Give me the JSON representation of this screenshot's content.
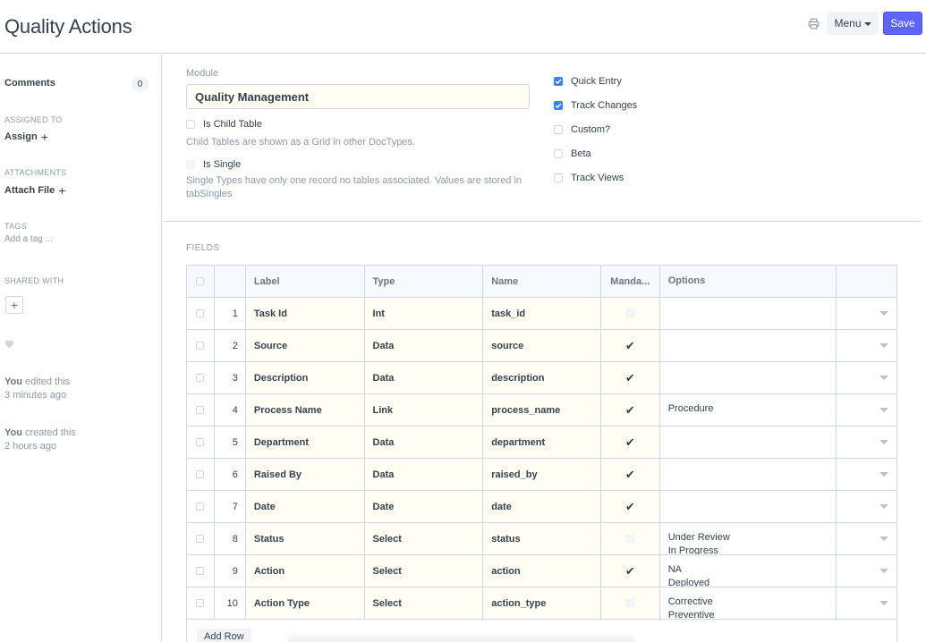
{
  "header": {
    "title": "Quality Actions",
    "menu_label": "Menu",
    "save_label": "Save",
    "print_icon": "printer-icon"
  },
  "sidebar": {
    "comments_label": "Comments",
    "comments_count": "0",
    "assigned_to_label": "Assigned To",
    "assign_label": "Assign",
    "attachments_label": "Attachments",
    "attach_label": "Attach File",
    "tags_label": "Tags",
    "add_tag_placeholder": "Add a tag ...",
    "shared_with_label": "Shared With",
    "activity": [
      {
        "who": "You",
        "what": " edited this",
        "when": "3 minutes ago"
      },
      {
        "who": "You",
        "what": " created this",
        "when": "2 hours ago"
      }
    ]
  },
  "form": {
    "module_label": "Module",
    "module_value": "Quality Management",
    "is_child_table_label": "Is Child Table",
    "is_child_table_help": "Child Tables are shown as a Grid in other DocTypes.",
    "is_single_label": "Is Single",
    "is_single_help": "Single Types have only one record no tables associated. Values are stored in tabSingles",
    "right_checks": [
      {
        "label": "Quick Entry",
        "checked": true
      },
      {
        "label": "Track Changes",
        "checked": true
      },
      {
        "label": "Custom?",
        "checked": false
      },
      {
        "label": "Beta",
        "checked": false
      },
      {
        "label": "Track Views",
        "checked": false
      }
    ]
  },
  "fields": {
    "section_label": "FIELDS",
    "columns": {
      "label": "Label",
      "type": "Type",
      "name": "Name",
      "mandatory": "Manda...",
      "options": "Options"
    },
    "rows": [
      {
        "idx": "1",
        "label": "Task Id",
        "type": "Int",
        "name": "task_id",
        "mandatory": false,
        "options": [
          "",
          ""
        ]
      },
      {
        "idx": "2",
        "label": "Source",
        "type": "Data",
        "name": "source",
        "mandatory": true,
        "options": [
          "",
          ""
        ]
      },
      {
        "idx": "3",
        "label": "Description",
        "type": "Data",
        "name": "description",
        "mandatory": true,
        "options": [
          "",
          ""
        ]
      },
      {
        "idx": "4",
        "label": "Process Name",
        "type": "Link",
        "name": "process_name",
        "mandatory": true,
        "options": [
          "Procedure",
          ""
        ]
      },
      {
        "idx": "5",
        "label": "Department",
        "type": "Data",
        "name": "department",
        "mandatory": true,
        "options": [
          "",
          ""
        ]
      },
      {
        "idx": "6",
        "label": "Raised By",
        "type": "Data",
        "name": "raised_by",
        "mandatory": true,
        "options": [
          "",
          ""
        ]
      },
      {
        "idx": "7",
        "label": "Date",
        "type": "Date",
        "name": "date",
        "mandatory": true,
        "options": [
          "",
          ""
        ]
      },
      {
        "idx": "8",
        "label": "Status",
        "type": "Select",
        "name": "status",
        "mandatory": false,
        "options": [
          "Under Review",
          "In Progress"
        ]
      },
      {
        "idx": "9",
        "label": "Action",
        "type": "Select",
        "name": "action",
        "mandatory": true,
        "options": [
          "NA",
          "Deployed"
        ]
      },
      {
        "idx": "10",
        "label": "Action Type",
        "type": "Select",
        "name": "action_type",
        "mandatory": false,
        "options": [
          "Corrective",
          "Preventive"
        ]
      }
    ],
    "add_row_label": "Add Row",
    "mandatory_tick": "✔"
  }
}
